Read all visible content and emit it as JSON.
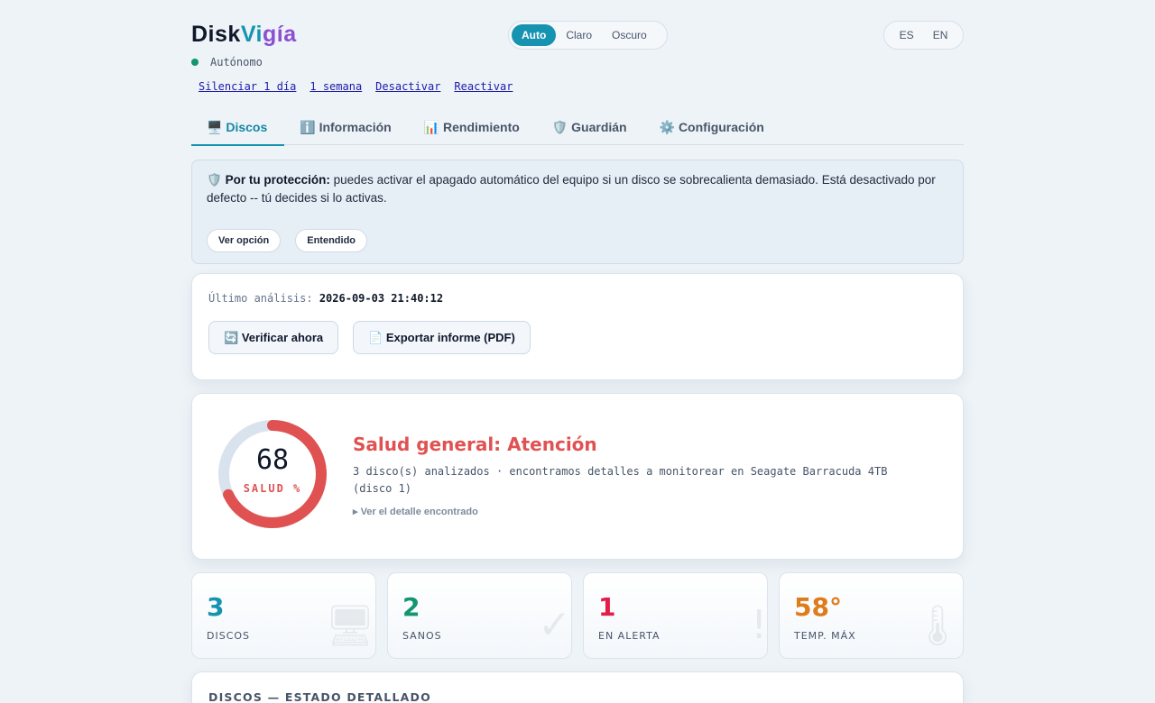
{
  "brand": {
    "part1": "Disk",
    "part2": "Vi",
    "part3": "gía"
  },
  "theme": {
    "options": [
      "Auto",
      "Claro",
      "Oscuro"
    ],
    "selected": "Auto"
  },
  "lang": {
    "options": [
      "ES",
      "EN"
    ]
  },
  "status": {
    "text": "Autónomo",
    "color": "#12966e"
  },
  "links": [
    "Silenciar 1 día",
    "1 semana",
    "Desactivar",
    "Reactivar"
  ],
  "tabs": [
    {
      "icon": "🖥️",
      "label": "Discos",
      "active": true
    },
    {
      "icon": "ℹ️",
      "label": "Información"
    },
    {
      "icon": "📊",
      "label": "Rendimiento"
    },
    {
      "icon": "🛡️",
      "label": "Guardián"
    },
    {
      "icon": "⚙️",
      "label": "Configuración"
    }
  ],
  "notice": {
    "icon": "🛡️",
    "bold": "Por tu protección:",
    "text": " puedes activar el apagado automático del equipo si un disco se sobrecalienta demasiado. Está desactivado por defecto -- tú decides si lo activas.",
    "btn_view": "Ver opción",
    "btn_ok": "Entendido"
  },
  "analysis": {
    "label": "Último análisis:",
    "timestamp": "2026-09-03 21:40:12",
    "verify_icon": "🔄",
    "verify": "Verificar ahora",
    "export_icon": "📄",
    "export": "Exportar informe (PDF)"
  },
  "health": {
    "score": "68",
    "score_value": 68,
    "unit_label": "SALUD %",
    "title": "Salud general: Atención",
    "description": "3 disco(s) analizados · encontramos detalles a monitorear en Seagate Barracuda 4TB (disco 1)",
    "more": "▸ Ver el detalle encontrado",
    "color": "#e05252"
  },
  "stats": [
    {
      "value": "3",
      "label": "DISCOS",
      "color": "#1693b1",
      "icon": "🖥"
    },
    {
      "value": "2",
      "label": "SANOS",
      "color": "#12966e",
      "icon": "✓"
    },
    {
      "value": "1",
      "label": "EN ALERTA",
      "color": "#e11d48",
      "icon": "!"
    },
    {
      "value": "58°",
      "label": "TEMP. MÁX",
      "color": "#e07b1a",
      "icon": "🌡"
    }
  ],
  "detail": {
    "title": "DISCOS — ESTADO DETALLADO"
  }
}
